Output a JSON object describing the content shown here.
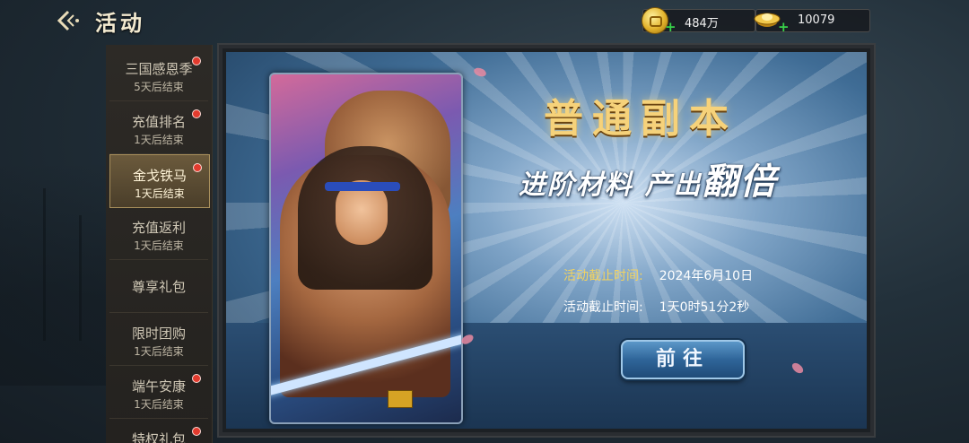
{
  "header": {
    "title": "活动",
    "back_icon": "back-arrow-icon",
    "resources": [
      {
        "icon": "gold-coin-icon",
        "value": "484万"
      },
      {
        "icon": "gold-ingot-icon",
        "value": "10079"
      }
    ]
  },
  "sidebar": {
    "items": [
      {
        "label": "三国感恩季",
        "sub": "5天后结束",
        "dot": true,
        "active": false
      },
      {
        "label": "充值排名",
        "sub": "1天后结束",
        "dot": true,
        "active": false
      },
      {
        "label": "金戈铁马",
        "sub": "1天后结束",
        "dot": true,
        "active": true
      },
      {
        "label": "充值返利",
        "sub": "1天后结束",
        "dot": false,
        "active": false
      },
      {
        "label": "尊享礼包",
        "sub": "",
        "dot": false,
        "active": false
      },
      {
        "label": "限时团购",
        "sub": "1天后结束",
        "dot": false,
        "active": false
      },
      {
        "label": "端午安康",
        "sub": "1天后结束",
        "dot": true,
        "active": false
      },
      {
        "label": "特权礼包",
        "sub": "",
        "dot": true,
        "active": false
      }
    ]
  },
  "event": {
    "title": "普通副本",
    "subtitle_a": "进阶材料 产出",
    "subtitle_b": "翻倍",
    "end_label": "活动截止时间:",
    "end_value": "2024年6月10日",
    "remain_label": "活动截止时间:",
    "remain_value": "1天0时51分2秒",
    "button_label": "前往"
  },
  "colors": {
    "accent_gold": "#f4d35e",
    "notify_red": "#e23b2e",
    "button_blue": "#2f6599"
  }
}
